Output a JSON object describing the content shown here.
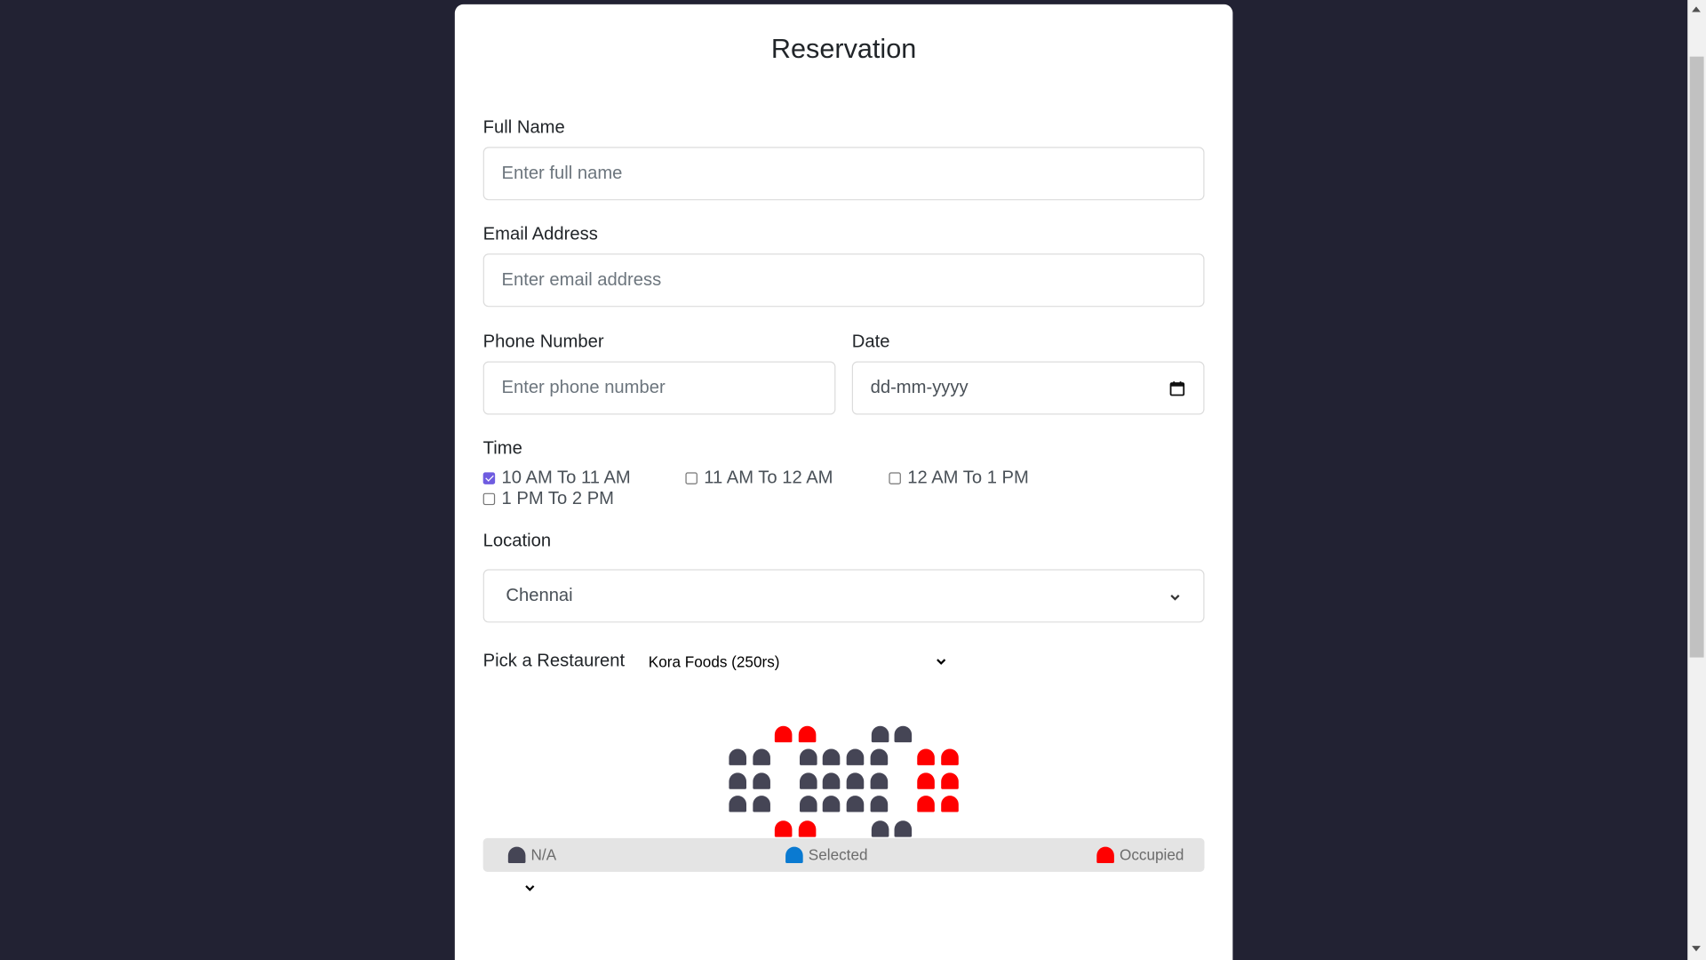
{
  "form": {
    "title": "Reservation",
    "full_name": {
      "label": "Full Name",
      "placeholder": "Enter full name",
      "value": ""
    },
    "email": {
      "label": "Email Address",
      "placeholder": "Enter email address",
      "value": ""
    },
    "phone": {
      "label": "Phone Number",
      "placeholder": "Enter phone number",
      "value": ""
    },
    "date": {
      "label": "Date",
      "placeholder": "dd-mm-yyyy"
    },
    "time": {
      "label": "Time",
      "options": [
        {
          "label": "10 AM To 11 AM",
          "checked": true
        },
        {
          "label": "11 AM To 12 AM",
          "checked": false
        },
        {
          "label": "12 AM To 1 PM",
          "checked": false
        },
        {
          "label": "1 PM To 2 PM",
          "checked": false
        }
      ]
    },
    "location": {
      "label": "Location",
      "selected": "Chennai"
    },
    "restaurant": {
      "label": "Pick a Restaurent",
      "selected": "Kora Foods (250rs)"
    }
  },
  "seat_map": {
    "colors": {
      "na": "#454555",
      "selected": "#0a7ad1",
      "occupied": "#ff0000"
    }
  },
  "legend": {
    "na": "N/A",
    "selected": "Selected",
    "occupied": "Occupied"
  }
}
